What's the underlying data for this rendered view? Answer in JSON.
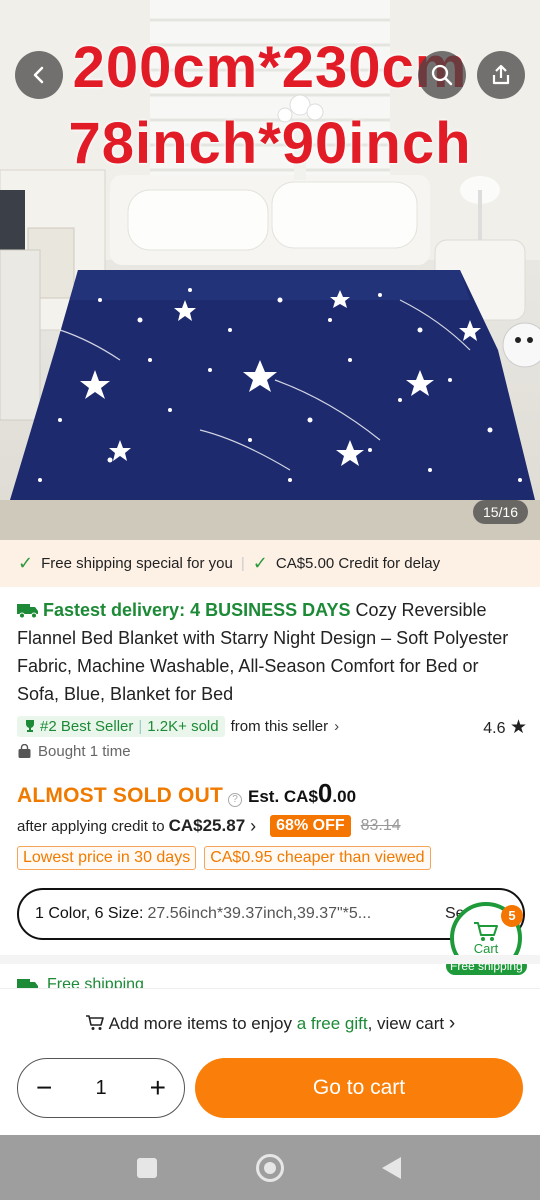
{
  "hero": {
    "line1": "200cm*230cm",
    "line2": "78inch*90inch",
    "counter": "15/16",
    "icons": [
      "back-arrow-icon",
      "search-icon",
      "share-icon"
    ]
  },
  "shipping_banner": {
    "item1": "Free shipping special for you",
    "item2": "CA$5.00 Credit for delay"
  },
  "product": {
    "fast_delivery": "Fastest delivery: 4 BUSINESS DAYS",
    "title": "Cozy Reversible Flannel Bed Blanket with Starry Night Design – Soft Polyester Fabric, Machine Washable, All-Season Comfort for Bed or Sofa, Blue, Blanket for Bed",
    "best_seller": "#2 Best Seller",
    "sold": "1.2K+ sold",
    "from_seller": "from this seller",
    "rating": "4.6",
    "bought": "Bought 1 time"
  },
  "price": {
    "almost_sold_out": "ALMOST SOLD OUT",
    "est_prefix": "Est. CA$",
    "est_big": "0",
    "est_cents": ".00",
    "credit_prefix": "after applying credit to",
    "credit_price": "CA$25.87",
    "off_badge": "68% OFF",
    "old_price": "83.14",
    "tag1": "Lowest price in 30 days",
    "tag2": "CA$0.95 cheaper than viewed"
  },
  "variant": {
    "label": "1 Color, 6 Size:",
    "value": "27.56inch*39.37inch,39.37\"*5...",
    "select_text": "Se"
  },
  "cart_fab": {
    "label": "Cart",
    "badge": "5",
    "shipping": "Free shipping"
  },
  "free_shipping_row": "Free shipping",
  "bottom": {
    "gift_prefix": "Add more items to enjoy",
    "gift_link": "a free gift",
    "gift_suffix": ", view cart",
    "quantity": "1",
    "minus": "−",
    "plus": "+",
    "go_to_cart": "Go to cart"
  },
  "colors": {
    "accent_orange": "#f97f0a",
    "green": "#1c8a36",
    "hero_text_red": "#e21c26",
    "blanket_navy": "#1d2a6e"
  }
}
